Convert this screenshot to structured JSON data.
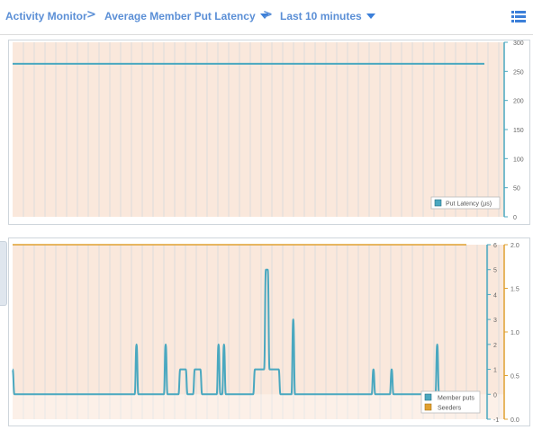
{
  "breadcrumb": {
    "root": "Activity Monitor",
    "metric": "Average Member Put Latency",
    "range": "Last 10 minutes",
    "separator": ">"
  },
  "icons": {
    "menu": "list-menu-icon",
    "dropdown": "caret-down-icon"
  },
  "colors": {
    "accent": "#5b8fd6",
    "series_teal": "#4aa8c0",
    "series_orange": "#e0a030",
    "fill": "#fae8dc"
  },
  "chart_data": [
    {
      "type": "line",
      "title": "",
      "legend": {
        "entries": [
          "Put Latency (µs)"
        ],
        "placement": "bottom-right"
      },
      "y_right": {
        "ticks": [
          "0",
          "50",
          "100",
          "150",
          "200",
          "250",
          "300"
        ],
        "ylim": [
          0,
          300
        ]
      },
      "grid": true,
      "series": [
        {
          "name": "Put Latency (µs)",
          "color": "#4aa8c0",
          "constant_value": 263
        }
      ]
    },
    {
      "type": "line",
      "title": "",
      "legend": {
        "entries": [
          "Member puts",
          "Seeders"
        ],
        "placement": "bottom-right"
      },
      "y_right_1": {
        "ticks": [
          "-1",
          "0",
          "1",
          "2",
          "3",
          "4",
          "5",
          "6"
        ],
        "ylim": [
          -1,
          6
        ]
      },
      "y_right_2": {
        "ticks": [
          "0.0",
          "0.5",
          "1.0",
          "1.5",
          "2.0"
        ],
        "ylim": [
          0,
          2
        ]
      },
      "grid": true,
      "series": [
        {
          "name": "Member puts",
          "color": "#4aa8c0",
          "axis": "left-scale",
          "values": [
            1,
            0,
            0,
            0,
            0,
            0,
            0,
            0,
            0,
            0,
            0,
            0,
            0,
            0,
            0,
            0,
            0,
            0,
            0,
            0,
            0,
            0,
            0,
            0,
            0,
            0,
            0,
            0,
            0,
            0,
            0,
            0,
            0,
            0,
            0,
            0,
            0,
            0,
            0,
            0,
            0,
            0,
            0,
            0,
            0,
            0,
            0,
            0,
            0,
            0,
            0,
            0,
            0,
            0,
            0,
            0,
            0,
            0,
            0,
            0,
            0,
            0,
            0,
            0,
            0,
            0,
            0,
            0,
            2,
            0,
            0,
            0,
            0,
            0,
            0,
            0,
            0,
            0,
            0,
            0,
            0,
            0,
            0,
            0,
            2,
            0,
            0,
            0,
            0,
            0,
            0,
            0,
            1,
            1,
            1,
            1,
            0,
            0,
            0,
            0,
            1,
            1,
            1,
            1,
            0,
            0,
            0,
            0,
            0,
            0,
            0,
            0,
            0,
            2,
            0,
            0,
            2,
            0,
            0,
            0,
            0,
            0,
            0,
            0,
            0,
            0,
            0,
            0,
            0,
            0,
            0,
            0,
            0,
            1,
            1,
            1,
            1,
            1,
            1,
            5,
            5,
            1,
            1,
            1,
            1,
            1,
            1,
            0,
            0,
            0,
            0,
            0,
            0,
            0,
            3,
            0,
            0,
            0,
            0,
            0,
            0,
            0,
            0,
            0,
            0,
            0,
            0,
            0,
            0,
            0,
            0,
            0,
            0,
            0,
            0,
            0,
            0,
            0,
            0,
            0,
            0,
            0,
            0,
            0,
            0,
            0,
            0,
            0,
            0,
            0,
            0,
            0,
            0,
            0,
            0,
            0,
            0,
            0,
            1,
            0,
            0,
            0,
            0,
            0,
            0,
            0,
            0,
            0,
            1,
            0,
            0,
            0,
            0,
            0,
            0,
            0,
            0,
            0,
            0,
            0,
            0,
            0,
            0,
            0,
            0,
            0,
            0,
            0,
            0,
            0,
            0,
            0,
            0,
            2,
            0,
            0,
            0,
            0,
            0,
            0,
            0,
            0,
            0,
            0,
            0,
            0,
            0,
            0,
            0,
            0
          ]
        },
        {
          "name": "Seeders",
          "color": "#e0a030",
          "axis": "right-scale",
          "constant_value": 2
        }
      ]
    }
  ]
}
